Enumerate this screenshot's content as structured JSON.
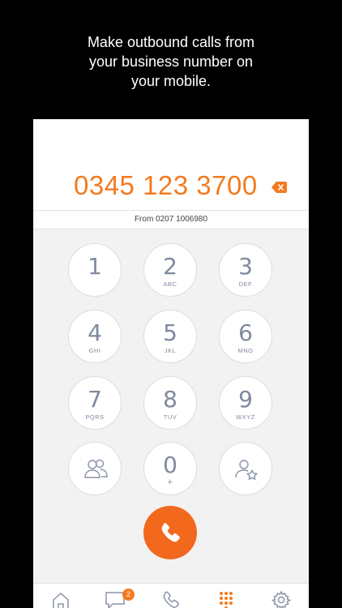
{
  "caption": {
    "line1": "Make outbound calls from",
    "line2": "your business number on",
    "line3": "your mobile."
  },
  "dialer": {
    "number": "0345 123 3700",
    "from_label": "From 0207 1006980",
    "keys": [
      {
        "digit": "1",
        "letters": ""
      },
      {
        "digit": "2",
        "letters": "ABC"
      },
      {
        "digit": "3",
        "letters": "DEF"
      },
      {
        "digit": "4",
        "letters": "GHI"
      },
      {
        "digit": "5",
        "letters": "JKL"
      },
      {
        "digit": "6",
        "letters": "MNO"
      },
      {
        "digit": "7",
        "letters": "PQRS"
      },
      {
        "digit": "8",
        "letters": "TUV"
      },
      {
        "digit": "9",
        "letters": "WXYZ"
      },
      {
        "digit": "0",
        "letters": "+"
      }
    ]
  },
  "tabs": {
    "messages_badge": "2",
    "icons": [
      "home-icon",
      "messages-icon",
      "calls-icon",
      "keypad-icon",
      "settings-icon"
    ],
    "active": "keypad"
  },
  "colors": {
    "accent": "#f47a20",
    "call_button": "#f2681d",
    "key_text": "#7f8aa0"
  }
}
